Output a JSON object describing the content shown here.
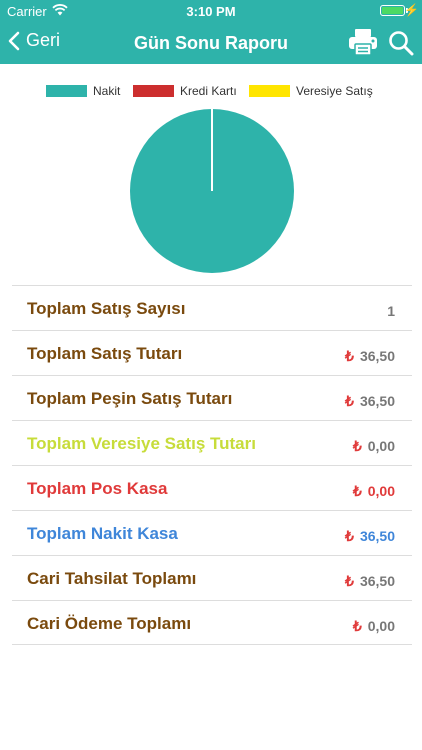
{
  "status_bar": {
    "carrier": "Carrier",
    "time": "3:10 PM"
  },
  "nav": {
    "back_label": "Geri",
    "title": "Gün Sonu Raporu",
    "back_icon": "chevron-left-icon",
    "print_icon": "printer-icon",
    "search_icon": "search-icon"
  },
  "colors": {
    "brand": "#2eb3aa",
    "brown": "#7a4a0e",
    "lime": "#c7dc3a",
    "red": "#e03a3a",
    "blue": "#3f86d9",
    "gray": "#777777"
  },
  "chart_data": {
    "type": "pie",
    "legend": [
      {
        "label": "Nakit",
        "color": "#2eb3aa"
      },
      {
        "label": "Kredi Kartı",
        "color": "#cc2e2e"
      },
      {
        "label": "Veresiye Satış",
        "color": "#ffe500"
      }
    ],
    "values": [
      36.5,
      0,
      0
    ],
    "legend_position": "top"
  },
  "stats": [
    {
      "label": "Toplam Satış Sayısı",
      "value": "1",
      "currency": "",
      "label_color": "#7a4a0e",
      "value_color": "#777777",
      "currency_color": "#777777"
    },
    {
      "label": "Toplam Satış Tutarı",
      "value": "36,50",
      "currency": "₺",
      "label_color": "#7a4a0e",
      "value_color": "#777777",
      "currency_color": "#e03a3a"
    },
    {
      "label": "Toplam Peşin Satış Tutarı",
      "value": "36,50",
      "currency": "₺",
      "label_color": "#7a4a0e",
      "value_color": "#777777",
      "currency_color": "#e03a3a"
    },
    {
      "label": "Toplam Veresiye Satış Tutarı",
      "value": "0,00",
      "currency": "₺",
      "label_color": "#c7dc3a",
      "value_color": "#777777",
      "currency_color": "#e03a3a"
    },
    {
      "label": "Toplam Pos Kasa",
      "value": "0,00",
      "currency": "₺",
      "label_color": "#e03a3a",
      "value_color": "#e03a3a",
      "currency_color": "#e03a3a"
    },
    {
      "label": "Toplam Nakit Kasa",
      "value": "36,50",
      "currency": "₺",
      "label_color": "#3f86d9",
      "value_color": "#3f86d9",
      "currency_color": "#e03a3a"
    },
    {
      "label": "Cari Tahsilat Toplamı",
      "value": "36,50",
      "currency": "₺",
      "label_color": "#7a4a0e",
      "value_color": "#777777",
      "currency_color": "#e03a3a"
    },
    {
      "label": "Cari Ödeme Toplamı",
      "value": "0,00",
      "currency": "₺",
      "label_color": "#7a4a0e",
      "value_color": "#777777",
      "currency_color": "#e03a3a"
    }
  ]
}
